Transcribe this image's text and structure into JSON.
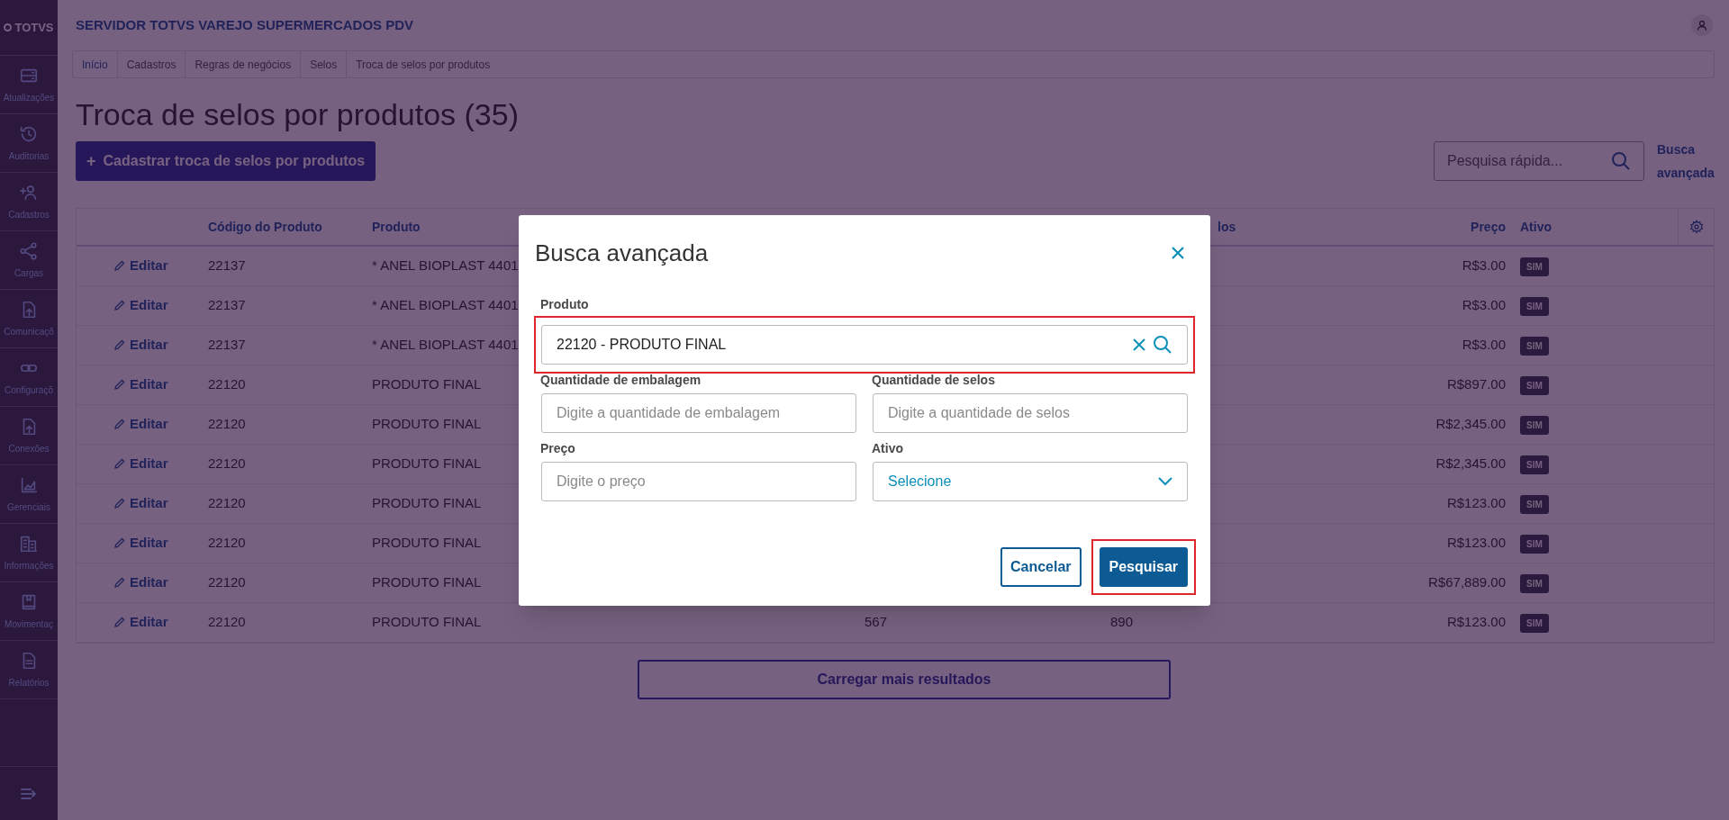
{
  "app_title": "SERVIDOR TOTVS VAREJO SUPERMERCADOS PDV",
  "logo": "TOTVS",
  "sidebar": {
    "items": [
      {
        "kind": "server",
        "label": "Atualizações"
      },
      {
        "kind": "history",
        "label": "Auditorias"
      },
      {
        "kind": "user-add",
        "label": "Cadastros"
      },
      {
        "kind": "share",
        "label": "Cargas"
      },
      {
        "kind": "upload",
        "label": "Comunicaçõ"
      },
      {
        "kind": "link",
        "label": "Configuraçõ"
      },
      {
        "kind": "upload",
        "label": "Conexões"
      },
      {
        "kind": "chart",
        "label": "Gerenciais"
      },
      {
        "kind": "building",
        "label": "Informações"
      },
      {
        "kind": "book",
        "label": "Movimentaç"
      },
      {
        "kind": "document",
        "label": "Relatórios"
      }
    ]
  },
  "breadcrumb": [
    "Início",
    "Cadastros",
    "Regras de negócios",
    "Selos",
    "Troca de selos por produtos"
  ],
  "page_title": "Troca de selos por produtos (35)",
  "add_button": {
    "icon": "+",
    "label": "Cadastrar troca de selos por produtos"
  },
  "search": {
    "placeholder": "Pesquisa rápida..."
  },
  "advanced_search_link": "Busca avançada",
  "table": {
    "headers": {
      "code": "Código do Produto",
      "product": "Produto",
      "column_5": "los",
      "price": "Preço",
      "active": "Ativo"
    },
    "rows": [
      {
        "action": "Editar",
        "code": "22137",
        "product": "* ANEL BIOPLAST 4401",
        "price": "R$3.00",
        "active": "SIM"
      },
      {
        "action": "Editar",
        "code": "22137",
        "product": "* ANEL BIOPLAST 4401",
        "price": "R$3.00",
        "active": "SIM"
      },
      {
        "action": "Editar",
        "code": "22137",
        "product": "* ANEL BIOPLAST 4401",
        "price": "R$3.00",
        "active": "SIM"
      },
      {
        "action": "Editar",
        "code": "22120",
        "product": "PRODUTO FINAL",
        "price": "R$897.00",
        "active": "SIM"
      },
      {
        "action": "Editar",
        "code": "22120",
        "product": "PRODUTO FINAL",
        "price": "R$2,345.00",
        "active": "SIM"
      },
      {
        "action": "Editar",
        "code": "22120",
        "product": "PRODUTO FINAL",
        "price": "R$2,345.00",
        "active": "SIM"
      },
      {
        "action": "Editar",
        "code": "22120",
        "product": "PRODUTO FINAL",
        "price": "R$123.00",
        "active": "SIM"
      },
      {
        "action": "Editar",
        "code": "22120",
        "product": "PRODUTO FINAL",
        "price": "R$123.00",
        "active": "SIM"
      },
      {
        "action": "Editar",
        "code": "22120",
        "product": "PRODUTO FINAL",
        "price": "R$67,889.00",
        "active": "SIM"
      },
      {
        "action": "Editar",
        "code": "22120",
        "product": "PRODUTO FINAL",
        "column_4": "567",
        "column_5": "890",
        "price": "R$123.00",
        "active": "SIM"
      }
    ]
  },
  "load_more": "Carregar mais resultados",
  "modal": {
    "title": "Busca avançada",
    "fields": [
      {
        "kind": "search",
        "label": "Produto",
        "value": "22120 - PRODUTO FINAL",
        "highlighted": true
      },
      {
        "kind": "text",
        "label": "Quantidade de embalagem",
        "placeholder": "Digite a quantidade de embalagem",
        "highlighted": false
      },
      {
        "kind": "text",
        "label": "Quantidade de selos",
        "placeholder": "Digite a quantidade de selos",
        "highlighted": false
      },
      {
        "kind": "text",
        "label": "Preço",
        "placeholder": "Digite o preço",
        "highlighted": false
      },
      {
        "kind": "select",
        "label": "Ativo",
        "value": "Selecione",
        "highlighted": false
      }
    ],
    "buttons": [
      {
        "kind": "secondary",
        "label": "Cancelar",
        "highlighted": false
      },
      {
        "kind": "primary",
        "label": "Pesquisar",
        "highlighted": true
      }
    ]
  }
}
